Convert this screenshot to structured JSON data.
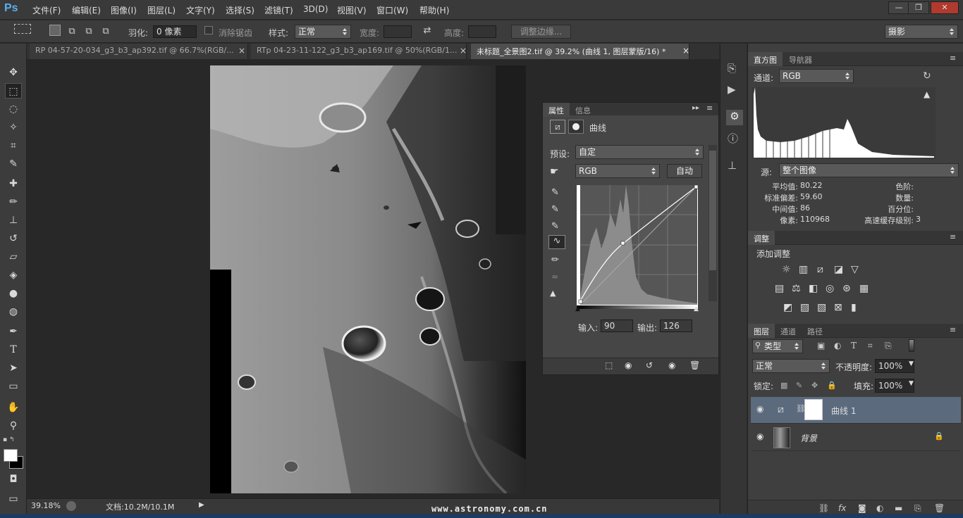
{
  "app": {
    "logo": "Ps"
  },
  "menu": [
    "文件(F)",
    "编辑(E)",
    "图像(I)",
    "图层(L)",
    "文字(Y)",
    "选择(S)",
    "滤镜(T)",
    "3D(D)",
    "视图(V)",
    "窗口(W)",
    "帮助(H)"
  ],
  "window_controls": {
    "minimize": "—",
    "restore": "❐",
    "close": "✕"
  },
  "options": {
    "feather_label": "羽化:",
    "feather_value": "0 像素",
    "antialias_label": "消除锯齿",
    "style_label": "样式:",
    "style_value": "正常",
    "width_label": "宽度:",
    "height_label": "高度:",
    "refine_button": "调整边缘...",
    "workspace": "摄影"
  },
  "tabs": [
    {
      "label": "RP 04-57-20-034_g3_b3_ap392.tif @ 66.7%(RGB/...",
      "close": "×"
    },
    {
      "label": "RTp 04-23-11-122_g3_b3_ap169.tif @ 50%(RGB/1...",
      "close": "×"
    },
    {
      "label": "未标题_全景图2.tif @ 39.2% (曲线 1, 图层蒙版/16) *",
      "close": "×"
    }
  ],
  "status": {
    "zoom": "39.18%",
    "doc": "文档:10.2M/10.1M"
  },
  "watermark": "www.astronomy.com.cn",
  "properties": {
    "tabs": [
      "属性",
      "信息"
    ],
    "title": "曲线",
    "preset_label": "预设:",
    "preset_value": "自定",
    "channel_value": "RGB",
    "auto_button": "自动",
    "input_label": "输入:",
    "input_value": "90",
    "output_label": "输出:",
    "output_value": "126"
  },
  "histogram": {
    "tabs": [
      "直方图",
      "导航器"
    ],
    "channel_label": "通道:",
    "channel_value": "RGB",
    "source_label": "源:",
    "source_value": "整个图像",
    "stats": [
      {
        "label": "平均值:",
        "value": "80.22"
      },
      {
        "label": "标准偏差:",
        "value": "59.60"
      },
      {
        "label": "中间值:",
        "value": "86"
      },
      {
        "label": "像素:",
        "value": "110968"
      }
    ],
    "stats2": [
      {
        "label": "色阶:",
        "value": ""
      },
      {
        "label": "数量:",
        "value": ""
      },
      {
        "label": "百分位:",
        "value": ""
      },
      {
        "label": "高速缓存级别:",
        "value": "3"
      }
    ]
  },
  "adjustments": {
    "tab": "调整",
    "title": "添加调整"
  },
  "layers": {
    "tabs": [
      "图层",
      "通道",
      "路径"
    ],
    "filter": "类型",
    "blend": "正常",
    "opacity_label": "不透明度:",
    "opacity_value": "100%",
    "lock_label": "锁定:",
    "fill_label": "填充:",
    "fill_value": "100%",
    "items": [
      {
        "name": "曲线 1"
      },
      {
        "name": "背景"
      }
    ]
  }
}
